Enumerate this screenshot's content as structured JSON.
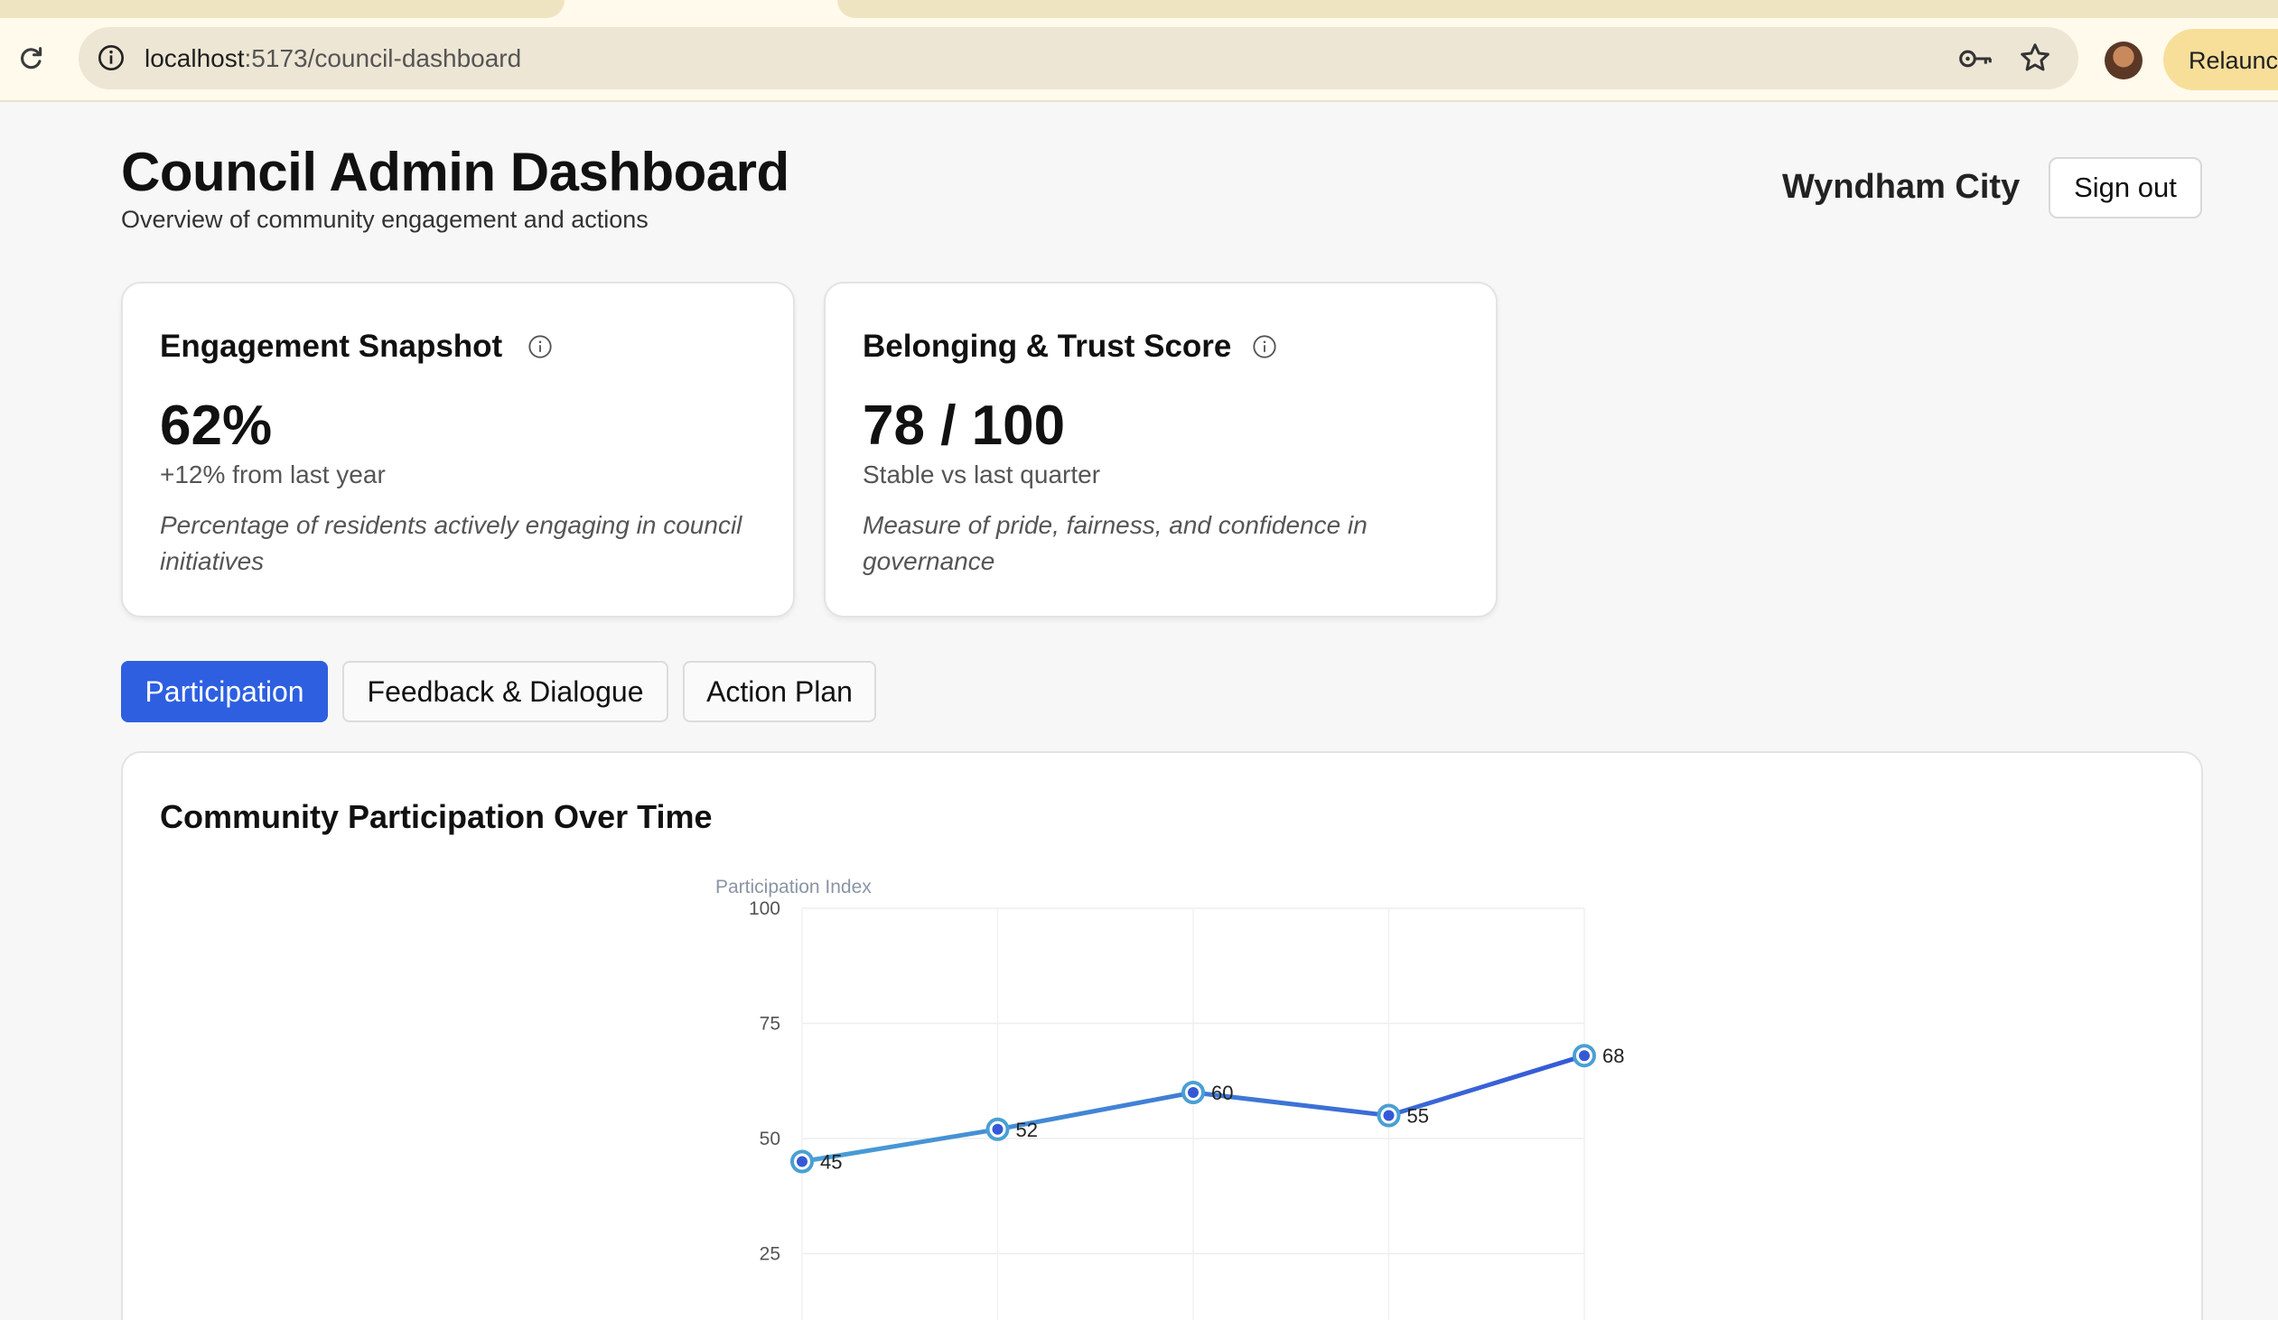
{
  "browser": {
    "url_host": "localhost",
    "url_path": ":5173/council-dashboard",
    "relaunch_label": "Relaunch"
  },
  "header": {
    "title": "Council Admin Dashboard",
    "subtitle": "Overview of community engagement and actions",
    "council_name": "Wyndham City",
    "sign_out_label": "Sign out"
  },
  "cards": [
    {
      "title": "Engagement Snapshot",
      "value": "62%",
      "change": "+12% from last year",
      "description": "Percentage of residents actively engaging in council initiatives"
    },
    {
      "title": "Belonging & Trust Score",
      "value": "78 / 100",
      "change": "Stable vs last quarter",
      "description": "Measure of pride, fairness, and confidence in governance"
    }
  ],
  "tabs": [
    {
      "label": "Participation",
      "active": true
    },
    {
      "label": "Feedback & Dialogue",
      "active": false
    },
    {
      "label": "Action Plan",
      "active": false
    }
  ],
  "colors": {
    "accent": "#2d5fe0",
    "line_start": "#4a9fd4",
    "line_end": "#3559d6"
  },
  "chart_panel": {
    "title": "Community Participation Over Time"
  },
  "chart_data": {
    "type": "line",
    "title": "",
    "ylabel": "Participation Index",
    "xlabel": "",
    "ylim": [
      0,
      100
    ],
    "yticks": [
      25,
      50,
      75,
      100
    ],
    "grid": true,
    "series": [
      {
        "values": [
          45,
          52,
          60,
          55,
          68
        ]
      }
    ]
  }
}
